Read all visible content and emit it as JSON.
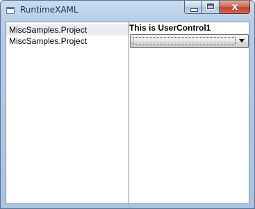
{
  "window": {
    "title": "RuntimeXAML",
    "icons": {
      "app": "window-app-icon",
      "minimize": "minimize-icon",
      "maximize": "maximize-icon",
      "close": "close-icon"
    },
    "close_glyph": "x"
  },
  "listbox": {
    "items": [
      {
        "label": "MiscSamples.Project",
        "selected": true
      },
      {
        "label": "MiscSamples.Project",
        "selected": false
      }
    ]
  },
  "user_control": {
    "title": "This is UserControl1",
    "combo": {
      "selected_value": "",
      "arrow_icon": "chevron-down-icon"
    }
  }
}
